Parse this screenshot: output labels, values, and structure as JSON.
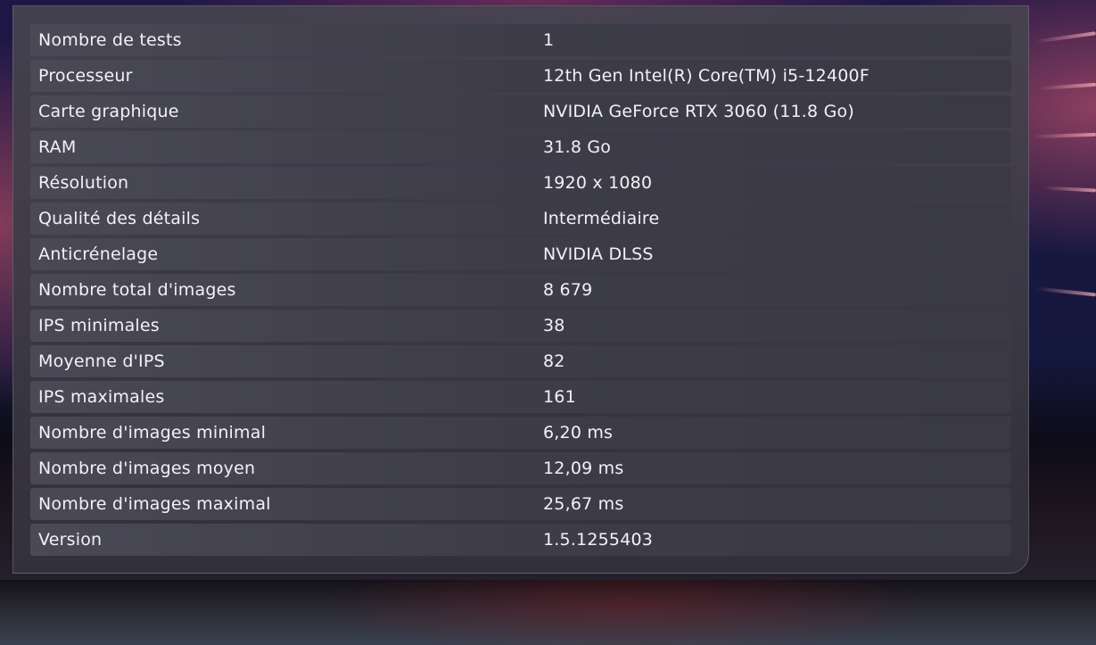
{
  "benchmark_table": {
    "rows": [
      {
        "label": "Nombre de tests",
        "value": "1"
      },
      {
        "label": "Processeur",
        "value": "12th Gen Intel(R) Core(TM) i5-12400F"
      },
      {
        "label": "Carte graphique",
        "value": "NVIDIA GeForce RTX 3060 (11.8 Go)"
      },
      {
        "label": "RAM",
        "value": "31.8 Go"
      },
      {
        "label": "Résolution",
        "value": "1920 x 1080"
      },
      {
        "label": "Qualité des détails",
        "value": "Intermédiaire"
      },
      {
        "label": "Anticrénelage",
        "value": "NVIDIA DLSS"
      },
      {
        "label": "Nombre total d'images",
        "value": "8 679"
      },
      {
        "label": "IPS minimales",
        "value": "38"
      },
      {
        "label": "Moyenne d'IPS",
        "value": "82"
      },
      {
        "label": "IPS maximales",
        "value": "161"
      },
      {
        "label": "Nombre d'images minimal",
        "value": "6,20 ms"
      },
      {
        "label": "Nombre d'images moyen",
        "value": "12,09 ms"
      },
      {
        "label": "Nombre d'images maximal",
        "value": "25,67 ms"
      },
      {
        "label": "Version",
        "value": "1.5.1255403"
      }
    ]
  }
}
